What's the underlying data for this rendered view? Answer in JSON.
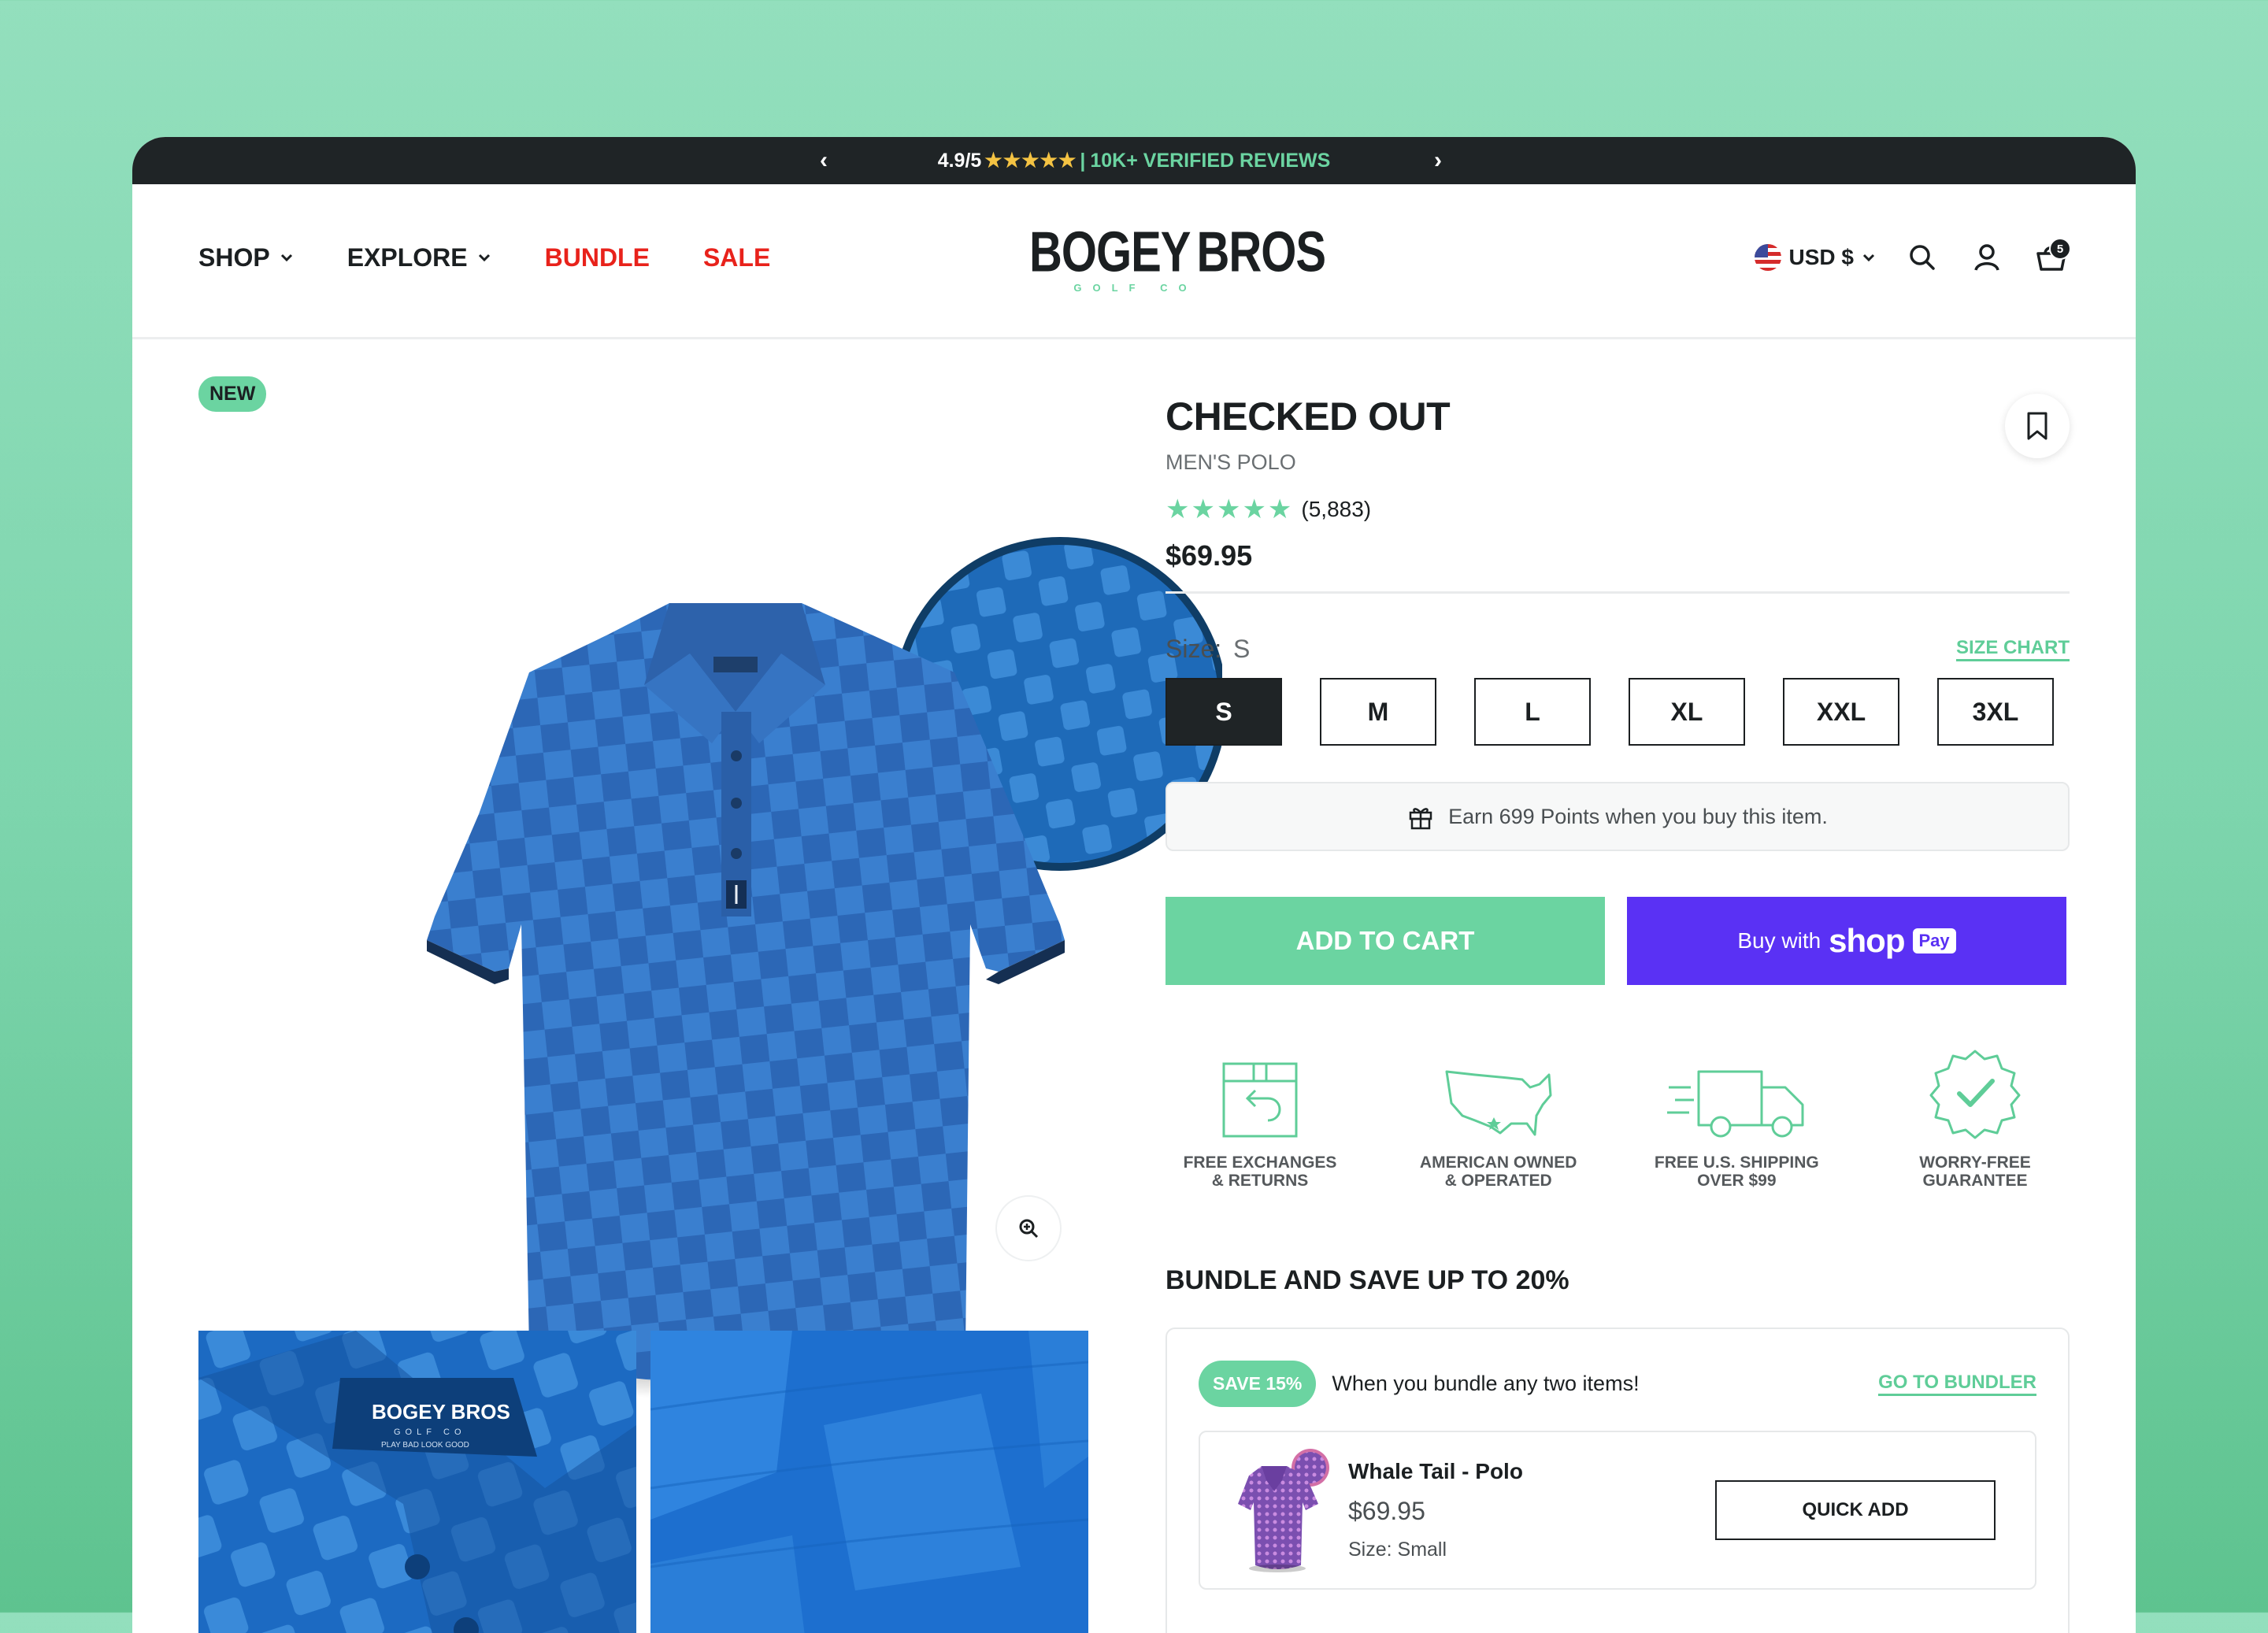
{
  "announcement": {
    "rating": "4.9/5",
    "stars": "★★★★★",
    "separator": "|",
    "reviews": "10K+ VERIFIED REVIEWS"
  },
  "nav": {
    "shop": "SHOP",
    "explore": "EXPLORE",
    "bundle": "BUNDLE",
    "sale": "SALE"
  },
  "logo": {
    "left": "BOGEY",
    "right": "BROS",
    "sub": "GOLF CO"
  },
  "header": {
    "currency": "USD $",
    "cart_count": "5"
  },
  "gallery": {
    "badge": "NEW",
    "collar_label_line1": "BOGEY BROS",
    "collar_label_line2": "GOLF CO",
    "collar_label_line3": "PLAY BAD LOOK GOOD"
  },
  "product": {
    "title": "CHECKED OUT",
    "subtitle": "MEN'S POLO",
    "stars": "★★★★★",
    "review_count": "(5,883)",
    "price": "$69.95",
    "size_label": "Size:",
    "size_selected": "S",
    "size_chart": "SIZE CHART",
    "sizes": [
      "S",
      "M",
      "L",
      "XL",
      "XXL",
      "3XL"
    ],
    "points_text": "Earn 699 Points when you buy this item.",
    "add_to_cart": "ADD TO CART",
    "buy_with": "Buy with",
    "shop_word": "shop",
    "pay_word": "Pay"
  },
  "features": [
    {
      "icon": "box-return-icon",
      "label": "FREE EXCHANGES\n& RETURNS"
    },
    {
      "icon": "usa-map-icon",
      "label": "AMERICAN OWNED\n& OPERATED"
    },
    {
      "icon": "delivery-truck-icon",
      "label": "FREE U.S. SHIPPING\nOVER $99"
    },
    {
      "icon": "guarantee-badge-icon",
      "label": "WORRY-FREE\nGUARANTEE"
    }
  ],
  "bundle": {
    "title": "BUNDLE AND SAVE UP TO 20%",
    "badge": "SAVE 15%",
    "text": "When you bundle any two items!",
    "link": "GO TO BUNDLER",
    "item": {
      "name": "Whale Tail - Polo",
      "price": "$69.95",
      "size": "Size: Small",
      "button": "QUICK ADD"
    }
  },
  "colors": {
    "accent_green": "#6bd4a1",
    "sale_red": "#e8221b",
    "shop_pay_purple": "#5a31f4",
    "shirt_blue": "#2f6fc0",
    "dark": "#1f2426"
  }
}
